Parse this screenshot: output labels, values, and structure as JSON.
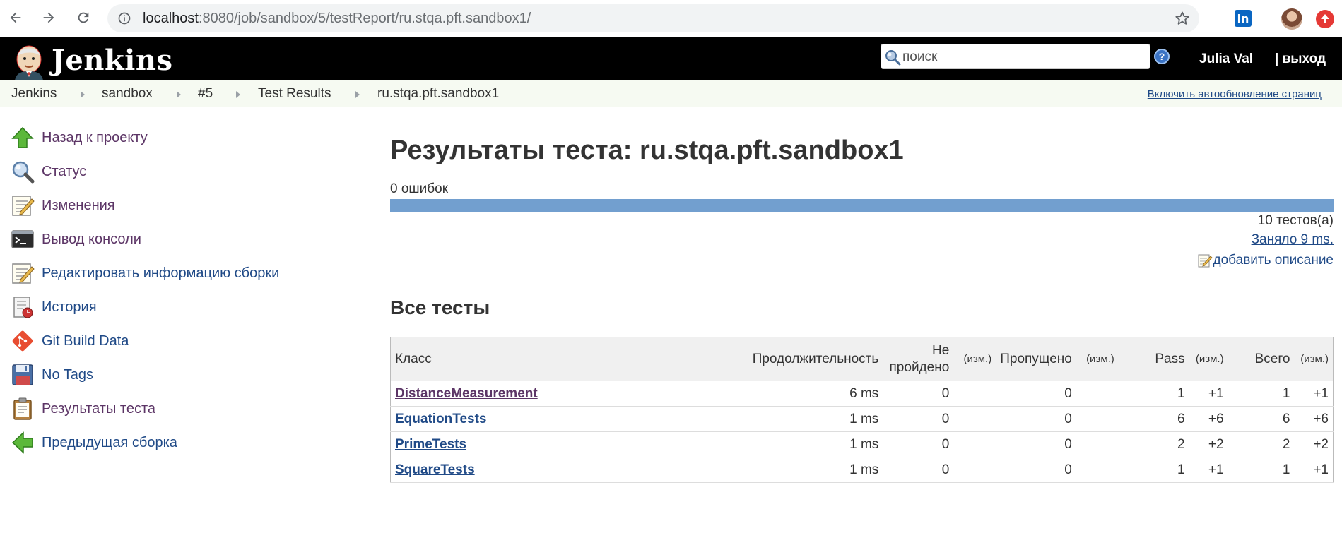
{
  "browser": {
    "url_host": "localhost",
    "url_rest": ":8080/job/sandbox/5/testReport/ru.stqa.pft.sandbox1/"
  },
  "header": {
    "logo_text": "Jenkins",
    "search_placeholder": "поиск",
    "help_label": "?",
    "user_name": "Julia Val",
    "logout_label": "| выход"
  },
  "breadcrumbs": [
    "Jenkins",
    "sandbox",
    "#5",
    "Test Results",
    "ru.stqa.pft.sandbox1"
  ],
  "auto_refresh_label": "Включить автообновление страниц",
  "sidebar": {
    "items": [
      {
        "label": "Назад к проекту",
        "icon": "up-arrow-icon"
      },
      {
        "label": "Статус",
        "icon": "magnifier-icon"
      },
      {
        "label": "Изменения",
        "icon": "notepad-icon"
      },
      {
        "label": "Вывод консоли",
        "icon": "terminal-icon"
      },
      {
        "label": "Редактировать информацию сборки",
        "icon": "notepad-icon"
      },
      {
        "label": "История",
        "icon": "history-icon"
      },
      {
        "label": "Git Build Data",
        "icon": "git-icon"
      },
      {
        "label": "No Tags",
        "icon": "floppy-disk-icon"
      },
      {
        "label": "Результаты теста",
        "icon": "clipboard-icon"
      },
      {
        "label": "Предыдущая сборка",
        "icon": "left-arrow-icon"
      }
    ]
  },
  "main": {
    "title": "Результаты теста: ru.stqa.pft.sandbox1",
    "failures": "0 ошибок",
    "pass_fraction": 1.0,
    "tests_total": "10 тестов(а)",
    "duration": "Заняло 9 ms.",
    "add_description": "добавить описание",
    "section_title": "Все тесты"
  },
  "table": {
    "headers": {
      "class": "Класс",
      "duration": "Продолжительность",
      "failed": "Не пройдено",
      "diff": "(изм.)",
      "skipped": "Пропущено",
      "pass": "Pass",
      "total": "Всего"
    },
    "rows": [
      {
        "name": "DistanceMeasurement",
        "duration": "6 ms",
        "failed": "0",
        "skipped": "0",
        "pass": "1",
        "pass_diff": "+1",
        "total": "1",
        "total_diff": "+1"
      },
      {
        "name": "EquationTests",
        "duration": "1 ms",
        "failed": "0",
        "skipped": "0",
        "pass": "6",
        "pass_diff": "+6",
        "total": "6",
        "total_diff": "+6"
      },
      {
        "name": "PrimeTests",
        "duration": "1 ms",
        "failed": "0",
        "skipped": "0",
        "pass": "2",
        "pass_diff": "+2",
        "total": "2",
        "total_diff": "+2"
      },
      {
        "name": "SquareTests",
        "duration": "1 ms",
        "failed": "0",
        "skipped": "0",
        "pass": "1",
        "pass_diff": "+1",
        "total": "1",
        "total_diff": "+1"
      }
    ]
  },
  "colors": {
    "header_bg": "#000000",
    "breadcrumb_bg": "#f6faf2",
    "link": "#204a87",
    "visited_link": "#5c3566",
    "progress_pass": "#729fcf"
  }
}
